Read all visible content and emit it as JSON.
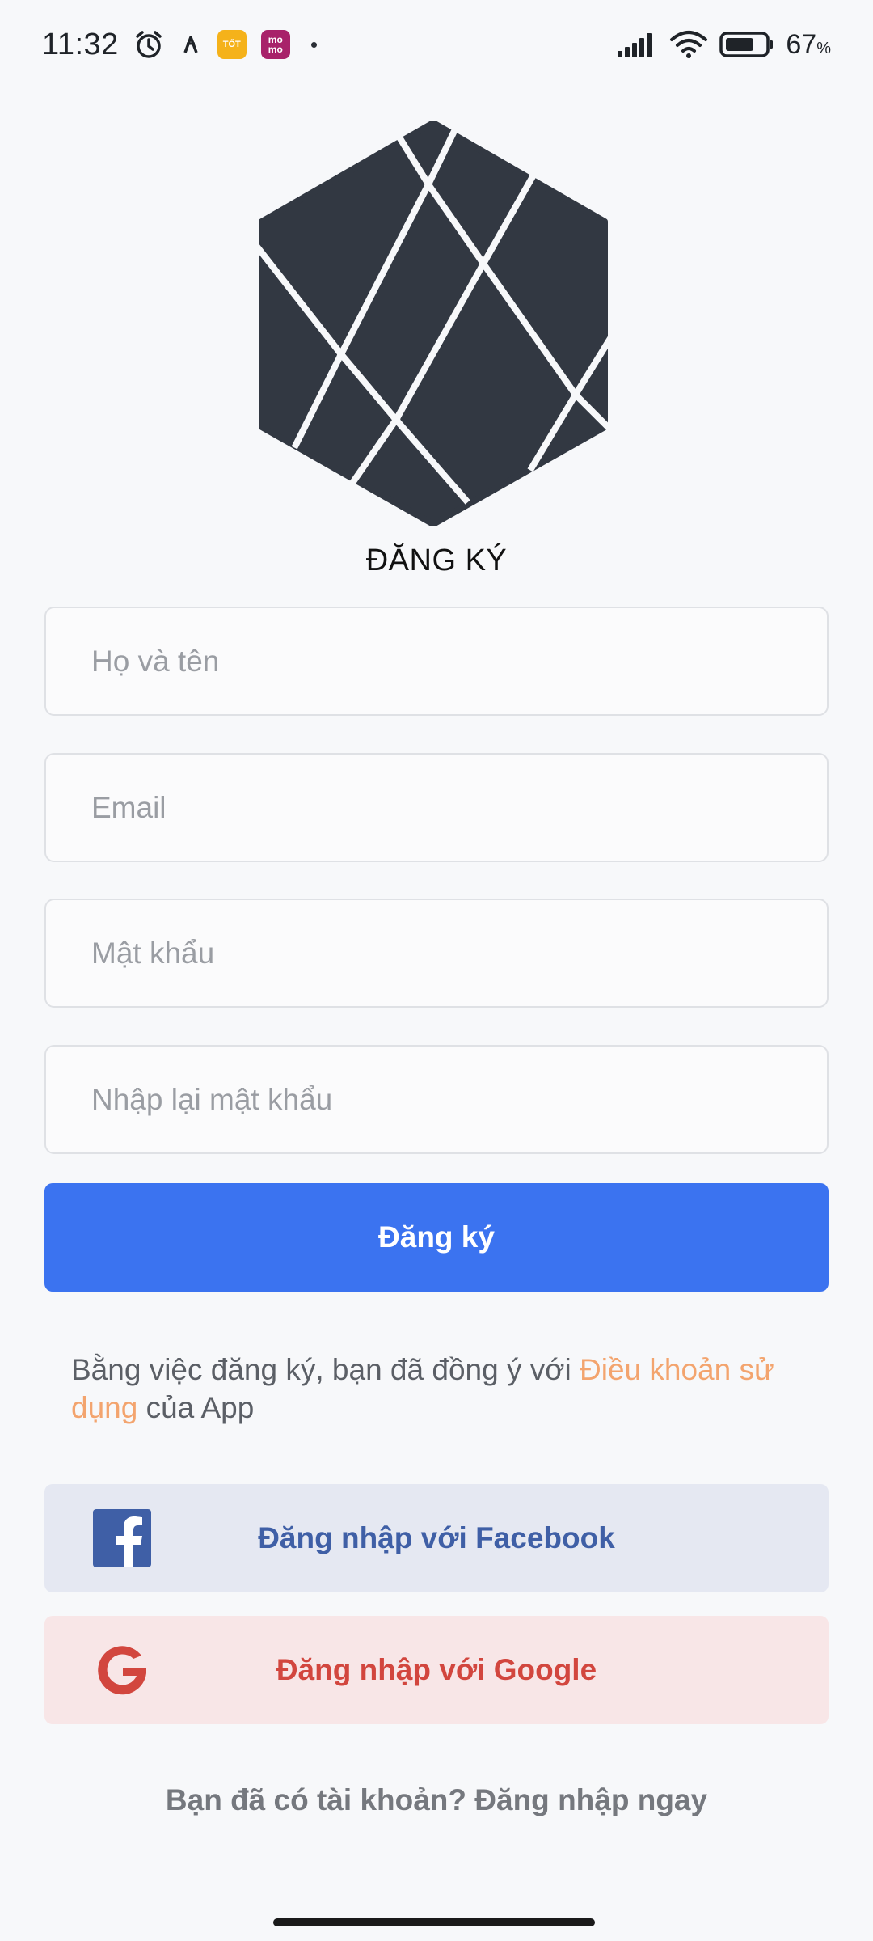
{
  "status_bar": {
    "time": "11:32",
    "battery_percent": "67",
    "battery_unit": "%",
    "badges": [
      {
        "name": "tot",
        "label": "TỐT",
        "color": "#f5b21a"
      },
      {
        "name": "momo",
        "label": "mo\nmo",
        "color": "#a8226a"
      }
    ],
    "icons": [
      "alarm-icon",
      "app-notification-icon",
      "signal-icon",
      "wifi-icon",
      "battery-icon"
    ]
  },
  "logo": {
    "icon": "hexagon-logo-icon",
    "color": "#323842"
  },
  "title": "ĐĂNG KÝ",
  "form": {
    "name_placeholder": "Họ và tên",
    "email_placeholder": "Email",
    "password_placeholder": "Mật khẩu",
    "confirm_password_placeholder": "Nhập lại mật khẩu",
    "submit_label": "Đăng ký"
  },
  "terms": {
    "prefix": "Bằng việc đăng ký, bạn đã đồng ý với ",
    "link": "Điều khoản sử dụng",
    "suffix": " của App"
  },
  "social": {
    "facebook_label": "Đăng nhập với Facebook",
    "google_label": "Đăng nhập với Google"
  },
  "footer": {
    "login_prompt": "Bạn đã có tài khoản? Đăng nhập ngay"
  },
  "colors": {
    "primary": "#3b73f0",
    "link": "#f3a46e",
    "facebook": "#3f5fa6",
    "google": "#d2463e"
  }
}
